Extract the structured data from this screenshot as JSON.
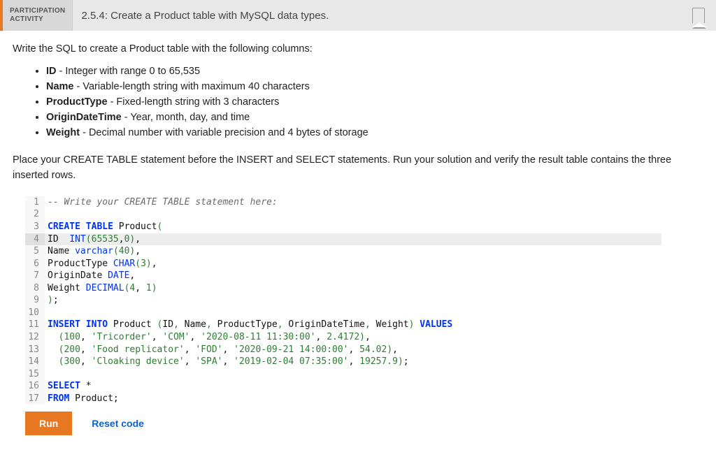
{
  "header": {
    "badge_line1": "PARTICIPATION",
    "badge_line2": "ACTIVITY",
    "title": "2.5.4: Create a Product table with MySQL data types."
  },
  "intro": "Write the SQL to create a Product table with the following columns:",
  "columns": [
    {
      "name": "ID",
      "desc": " - Integer with range 0 to 65,535"
    },
    {
      "name": "Name",
      "desc": " - Variable-length string with maximum 40 characters"
    },
    {
      "name": "ProductType",
      "desc": " - Fixed-length string with 3 characters"
    },
    {
      "name": "OriginDateTime",
      "desc": " - Year, month, day, and time"
    },
    {
      "name": "Weight",
      "desc": " - Decimal number with variable precision and 4 bytes of storage"
    }
  ],
  "explain": "Place your CREATE TABLE statement before the INSERT and SELECT statements. Run your solution and verify the result table contains the three inserted rows.",
  "code": {
    "highlight_line": 4,
    "lines": [
      {
        "n": 1,
        "tokens": [
          [
            "comment",
            "-- Write your CREATE TABLE statement here:"
          ]
        ]
      },
      {
        "n": 2,
        "tokens": []
      },
      {
        "n": 3,
        "tokens": [
          [
            "kw",
            "CREATE TABLE"
          ],
          [
            "ident",
            " Product"
          ],
          [
            "punct",
            "("
          ]
        ]
      },
      {
        "n": 4,
        "tokens": [
          [
            "ident",
            "ID  "
          ],
          [
            "type",
            "INT"
          ],
          [
            "punct",
            "("
          ],
          [
            "num",
            "65535"
          ],
          [
            "ident",
            ","
          ],
          [
            "num",
            "0"
          ],
          [
            "punct",
            ")"
          ],
          [
            "ident",
            ","
          ]
        ]
      },
      {
        "n": 5,
        "tokens": [
          [
            "ident",
            "Name "
          ],
          [
            "type",
            "varchar"
          ],
          [
            "punct",
            "("
          ],
          [
            "num",
            "40"
          ],
          [
            "punct",
            ")"
          ],
          [
            "ident",
            ","
          ]
        ]
      },
      {
        "n": 6,
        "tokens": [
          [
            "ident",
            "ProductType "
          ],
          [
            "type",
            "CHAR"
          ],
          [
            "punct",
            "("
          ],
          [
            "num",
            "3"
          ],
          [
            "punct",
            ")"
          ],
          [
            "ident",
            ","
          ]
        ]
      },
      {
        "n": 7,
        "tokens": [
          [
            "ident",
            "OriginDate "
          ],
          [
            "type",
            "DATE"
          ],
          [
            "ident",
            ","
          ]
        ]
      },
      {
        "n": 8,
        "tokens": [
          [
            "ident",
            "Weight "
          ],
          [
            "type",
            "DECIMAL"
          ],
          [
            "punct",
            "("
          ],
          [
            "num",
            "4"
          ],
          [
            "ident",
            ", "
          ],
          [
            "num",
            "1"
          ],
          [
            "punct",
            ")"
          ]
        ]
      },
      {
        "n": 9,
        "tokens": [
          [
            "punct",
            ")"
          ],
          [
            "ident",
            ";"
          ]
        ]
      },
      {
        "n": 10,
        "tokens": []
      },
      {
        "n": 11,
        "tokens": [
          [
            "kw",
            "INSERT INTO"
          ],
          [
            "ident",
            " Product "
          ],
          [
            "punct",
            "("
          ],
          [
            "ident",
            "ID"
          ],
          [
            "punct",
            ","
          ],
          [
            "ident",
            " Name"
          ],
          [
            "punct",
            ","
          ],
          [
            "ident",
            " ProductType"
          ],
          [
            "punct",
            ","
          ],
          [
            "ident",
            " OriginDateTime"
          ],
          [
            "punct",
            ","
          ],
          [
            "ident",
            " Weight"
          ],
          [
            "punct",
            ")"
          ],
          [
            "ident",
            " "
          ],
          [
            "kw",
            "VALUES"
          ]
        ]
      },
      {
        "n": 12,
        "tokens": [
          [
            "ident",
            "  "
          ],
          [
            "punct",
            "("
          ],
          [
            "num",
            "100"
          ],
          [
            "ident",
            ", "
          ],
          [
            "str",
            "'Tricorder'"
          ],
          [
            "ident",
            ", "
          ],
          [
            "str",
            "'COM'"
          ],
          [
            "ident",
            ", "
          ],
          [
            "str",
            "'2020-08-11 11:30:00'"
          ],
          [
            "ident",
            ", "
          ],
          [
            "num",
            "2.4172"
          ],
          [
            "punct",
            ")"
          ],
          [
            "ident",
            ","
          ]
        ]
      },
      {
        "n": 13,
        "tokens": [
          [
            "ident",
            "  "
          ],
          [
            "punct",
            "("
          ],
          [
            "num",
            "200"
          ],
          [
            "ident",
            ", "
          ],
          [
            "str",
            "'Food replicator'"
          ],
          [
            "ident",
            ", "
          ],
          [
            "str",
            "'FOD'"
          ],
          [
            "ident",
            ", "
          ],
          [
            "str",
            "'2020-09-21 14:00:00'"
          ],
          [
            "ident",
            ", "
          ],
          [
            "num",
            "54.02"
          ],
          [
            "punct",
            ")"
          ],
          [
            "ident",
            ","
          ]
        ]
      },
      {
        "n": 14,
        "tokens": [
          [
            "ident",
            "  "
          ],
          [
            "punct",
            "("
          ],
          [
            "num",
            "300"
          ],
          [
            "ident",
            ", "
          ],
          [
            "str",
            "'Cloaking device'"
          ],
          [
            "ident",
            ", "
          ],
          [
            "str",
            "'SPA'"
          ],
          [
            "ident",
            ", "
          ],
          [
            "str",
            "'2019-02-04 07:35:00'"
          ],
          [
            "ident",
            ", "
          ],
          [
            "num",
            "19257.9"
          ],
          [
            "punct",
            ")"
          ],
          [
            "ident",
            ";"
          ]
        ]
      },
      {
        "n": 15,
        "tokens": []
      },
      {
        "n": 16,
        "tokens": [
          [
            "kw",
            "SELECT"
          ],
          [
            "ident",
            " *"
          ]
        ]
      },
      {
        "n": 17,
        "tokens": [
          [
            "kw",
            "FROM"
          ],
          [
            "ident",
            " Product;"
          ]
        ]
      }
    ]
  },
  "actions": {
    "run": "Run",
    "reset": "Reset code"
  }
}
